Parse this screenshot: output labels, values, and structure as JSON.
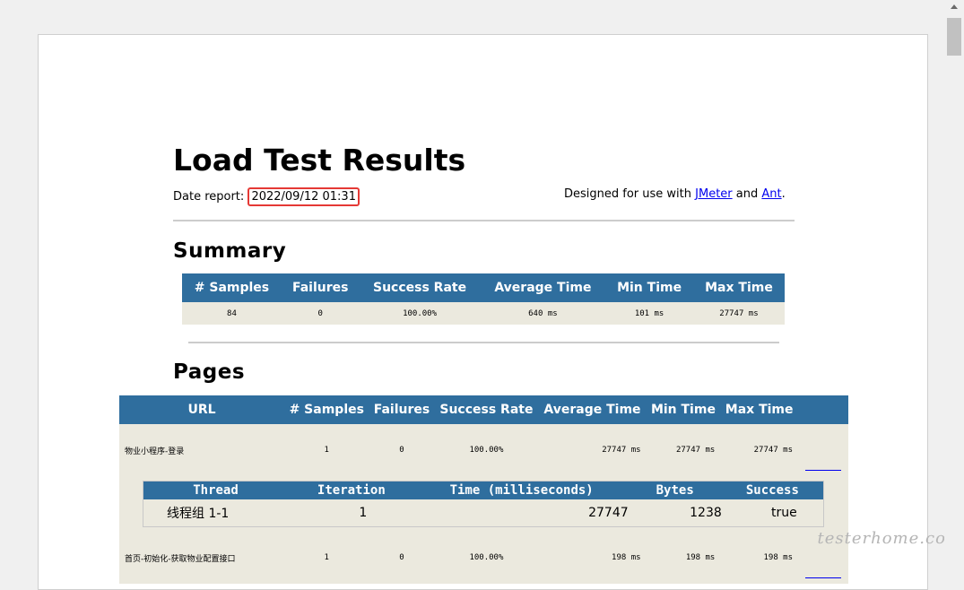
{
  "report": {
    "title": "Load Test Results",
    "date_label": "Date report:",
    "date_value": "2022/09/12 01:31",
    "designed_text": "Designed for use with",
    "link_jmeter": "JMeter",
    "and_text": "and",
    "link_ant": "Ant",
    "period": "."
  },
  "summary": {
    "heading": "Summary",
    "headers": [
      "# Samples",
      "Failures",
      "Success Rate",
      "Average Time",
      "Min Time",
      "Max Time"
    ],
    "row": [
      "84",
      "0",
      "100.00%",
      "640 ms",
      "101 ms",
      "27747 ms"
    ]
  },
  "pages": {
    "heading": "Pages",
    "headers": [
      "URL",
      "# Samples",
      "Failures",
      "Success Rate",
      "Average Time",
      "Min Time",
      "Max Time"
    ],
    "rows": [
      [
        "物业小程序-登录",
        "1",
        "0",
        "100.00%",
        "27747 ms",
        "27747 ms",
        "27747 ms"
      ],
      [
        "首页-初始化-获取物业配置接口",
        "1",
        "0",
        "100.00%",
        "198 ms",
        "198 ms",
        "198 ms"
      ]
    ],
    "detail": {
      "headers": [
        "Thread",
        "Iteration",
        "Time (milliseconds)",
        "Bytes",
        "Success"
      ],
      "row": [
        "线程组 1-1",
        "1",
        "27747",
        "1238",
        "true"
      ]
    }
  },
  "watermark": "testerhome.com",
  "colors": {
    "header_bg": "#2f6e9e",
    "row_bg": "#ebe9de",
    "highlight": "#e53935",
    "link": "#0000ee"
  }
}
